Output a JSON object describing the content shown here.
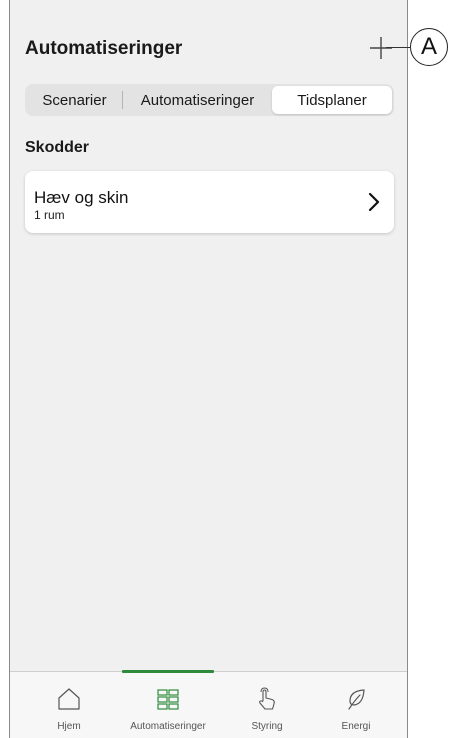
{
  "header": {
    "title": "Automatiseringer",
    "add_icon": "plus-icon"
  },
  "callout": {
    "label": "A"
  },
  "segments": [
    {
      "label": "Scenarier",
      "active": false
    },
    {
      "label": "Automatiseringer",
      "active": false
    },
    {
      "label": "Tidsplaner",
      "active": true
    }
  ],
  "section": {
    "title": "Skodder"
  },
  "items": [
    {
      "title": "Hæv og skin",
      "subtitle": "1 rum",
      "icon": "chevron-right-icon"
    }
  ],
  "tabs": [
    {
      "label": "Hjem",
      "icon": "home-icon",
      "active": false
    },
    {
      "label": "Automatiseringer",
      "icon": "grid-icon",
      "active": true
    },
    {
      "label": "Styring",
      "icon": "hand-icon",
      "active": false
    },
    {
      "label": "Energi",
      "icon": "leaf-icon",
      "active": false
    }
  ],
  "colors": {
    "accent": "#2e8b3c",
    "background": "#f0f0f0",
    "card": "#ffffff"
  }
}
